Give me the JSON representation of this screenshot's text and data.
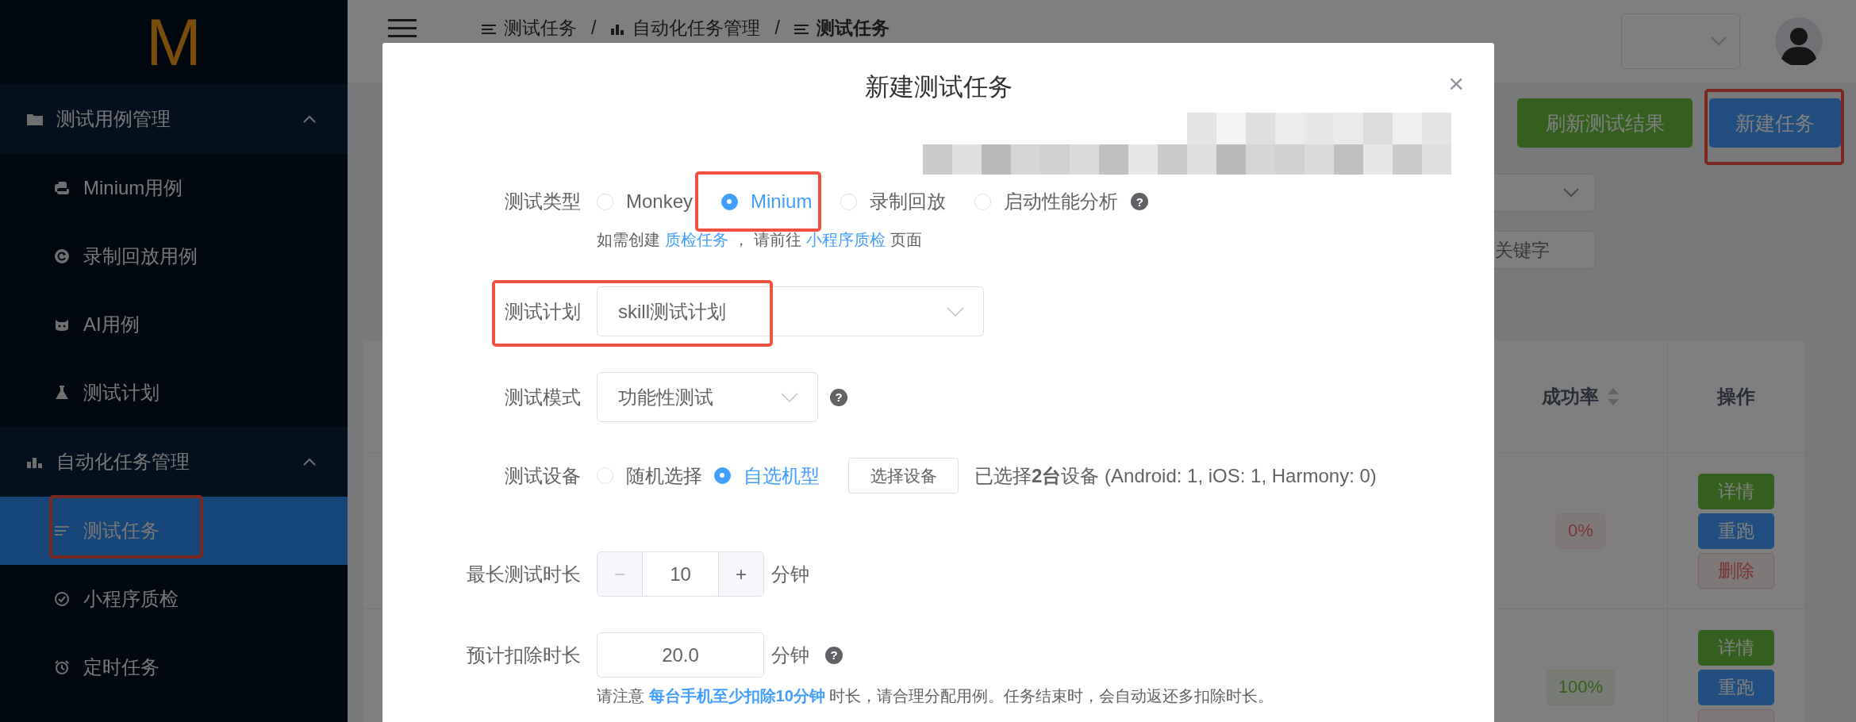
{
  "logo": "M",
  "sidebar": {
    "groups": [
      {
        "label": "测试用例管理",
        "expanded": true,
        "items": [
          {
            "label": "Minium用例",
            "selected": false,
            "annotated": false
          },
          {
            "label": "录制回放用例",
            "selected": false,
            "annotated": false
          },
          {
            "label": "AI用例",
            "selected": false,
            "annotated": false
          },
          {
            "label": "测试计划",
            "selected": false,
            "annotated": false
          }
        ]
      },
      {
        "label": "自动化任务管理",
        "expanded": true,
        "items": [
          {
            "label": "测试任务",
            "selected": true,
            "annotated": true
          },
          {
            "label": "小程序质检",
            "selected": false,
            "annotated": false
          },
          {
            "label": "定时任务",
            "selected": false,
            "annotated": false
          }
        ]
      }
    ]
  },
  "header": {
    "breadcrumb": [
      {
        "label": "测试任务",
        "current": false
      },
      {
        "separator": "/",
        "label": "自动化任务管理",
        "current": false
      },
      {
        "separator": "/",
        "label": "测试任务",
        "current": true
      }
    ]
  },
  "toolbar": [
    {
      "label": "刷新测试结果",
      "kind": "success",
      "annotated": false
    },
    {
      "label": "新建任务",
      "kind": "primary",
      "annotated": true
    }
  ],
  "filters": [
    {
      "kind": "select"
    },
    {
      "kind": "search",
      "placeholder": "关键字"
    }
  ],
  "table": {
    "columns": [
      {
        "label": "成功率",
        "sortable": true
      },
      {
        "label": "操作",
        "sortable": false
      }
    ],
    "rows": [
      {
        "success_rate": "0%",
        "kind": "danger",
        "actions": [
          {
            "label": "详情",
            "kind": "success"
          },
          {
            "label": "重跑",
            "kind": "primary"
          },
          {
            "label": "删除",
            "kind": "danger"
          }
        ]
      },
      {
        "success_rate": "100%",
        "kind": "success",
        "actions": [
          {
            "label": "详情",
            "kind": "success"
          },
          {
            "label": "重跑",
            "kind": "primary"
          },
          {
            "kind": "danger"
          }
        ]
      }
    ]
  },
  "dialog": {
    "title": "新建测试任务",
    "close": "×",
    "form": [
      {
        "kind": "radio",
        "label": "测试类型",
        "options": [
          {
            "label": "Monkey",
            "selected": false,
            "annotated": false
          },
          {
            "label": "Minium",
            "selected": true,
            "annotated": true
          },
          {
            "label": "录制回放",
            "selected": false,
            "annotated": false
          },
          {
            "label": "启动性能分析",
            "selected": false,
            "annotated": false,
            "help": "?"
          }
        ],
        "hint": [
          {
            "text": "如需创建",
            "link": false
          },
          {
            "text": "质检任务",
            "link": true
          },
          {
            "text": "， 请前往",
            "link": false
          },
          {
            "text": "小程序质检",
            "link": true
          },
          {
            "text": "页面",
            "link": false
          }
        ]
      },
      {
        "kind": "select",
        "label": "测试计划",
        "value": "skill测试计划",
        "annotated": true
      },
      {
        "kind": "select",
        "label": "测试模式",
        "value": "功能性测试",
        "annotated": false,
        "help": "?"
      },
      {
        "kind": "device",
        "label": "测试设备",
        "options": [
          {
            "label": "随机选择",
            "selected": false,
            "annotated": false
          },
          {
            "label": "自选机型",
            "selected": true,
            "annotated": false
          }
        ],
        "button": "选择设备",
        "summary": "已选择**2台**设备 (Android: 1, iOS: 1, Harmony: 0)"
      },
      {
        "kind": "number",
        "label": "最长测试时长",
        "minus": "−",
        "minus_disabled": true,
        "value": "10",
        "plus": "+",
        "unit": "分钟"
      },
      {
        "kind": "input",
        "label": "预计扣除时长",
        "value": "20.0",
        "unit": "分钟",
        "help": "?",
        "note": "请注意 **每台手机至少扣除10分钟** 时长，请合理分配用例。任务结束时，会自动返还多扣除时长。"
      }
    ]
  }
}
